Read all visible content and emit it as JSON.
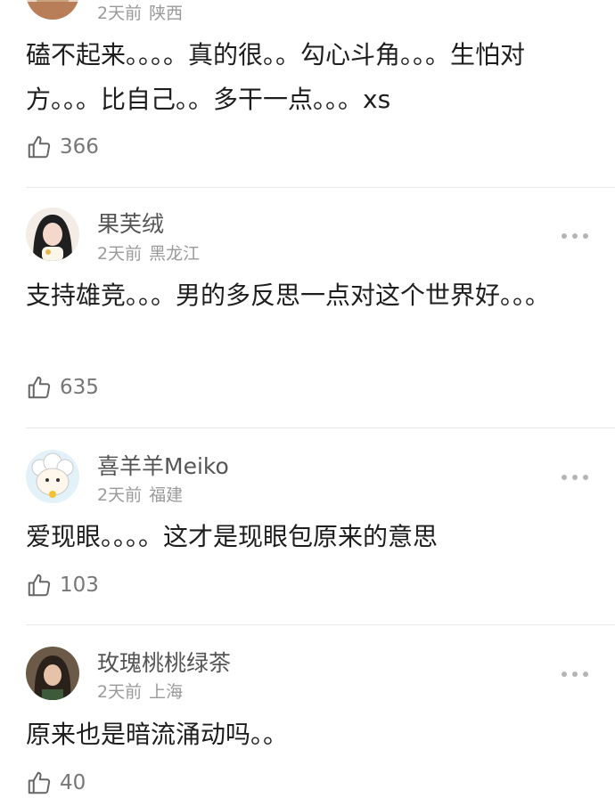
{
  "comments": [
    {
      "author": "",
      "time": "2天前",
      "location": "陕西",
      "text": "磕不起来。。。。真的很。。勾心斗角。。。生怕对方。。。比自己。。多干一点。。。xs",
      "likes": "366",
      "avatar_colors": [
        "#d9b38c",
        "#ffffff"
      ]
    },
    {
      "author": "果芙绒",
      "time": "2天前",
      "location": "黑龙江",
      "text": "支持雄竞。。。男的多反思一点对这个世界好。。。",
      "likes": "635",
      "avatar_colors": [
        "#2b2b2b",
        "#f3d9cf"
      ]
    },
    {
      "author": "喜羊羊Meiko",
      "time": "2天前",
      "location": "福建",
      "text": "爱现眼。。。。这才是现眼包原来的意思",
      "likes": "103",
      "avatar_colors": [
        "#cfe8f5",
        "#ffffff"
      ]
    },
    {
      "author": "玫瑰桃桃绿茶",
      "time": "2天前",
      "location": "上海",
      "text": "原来也是暗流涌动吗。。",
      "likes": "40",
      "avatar_colors": [
        "#5a4a3a",
        "#caa88a"
      ]
    }
  ],
  "colors": {
    "author": "#555555",
    "meta": "#9a9a9a",
    "text": "#1e1e1e",
    "divider": "#e8e8e8"
  },
  "icons": {
    "like": "thumbs-up-icon",
    "more": "more-dots-icon"
  }
}
